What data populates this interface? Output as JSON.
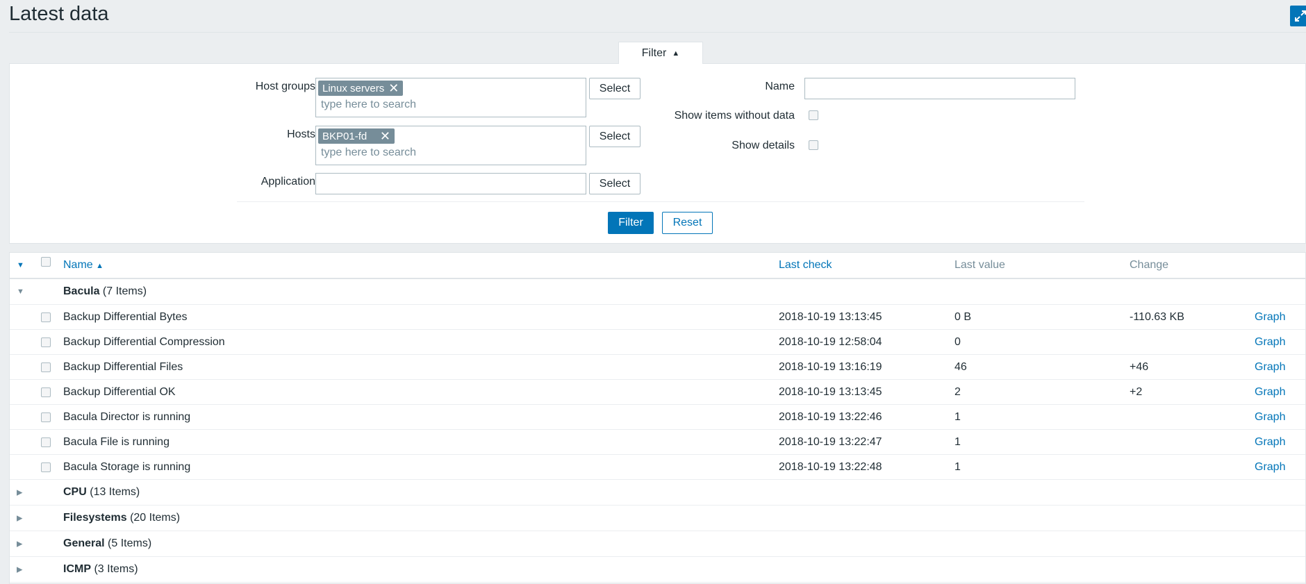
{
  "page": {
    "title": "Latest data"
  },
  "filter": {
    "tab_label": "Filter",
    "host_groups_label": "Host groups",
    "host_groups_tag": "Linux servers",
    "hosts_label": "Hosts",
    "hosts_tag": "BKP01-fd",
    "search_placeholder": "type here to search",
    "application_label": "Application",
    "select_label": "Select",
    "name_label": "Name",
    "show_without_data_label": "Show items without data",
    "show_details_label": "Show details",
    "filter_button": "Filter",
    "reset_button": "Reset"
  },
  "table": {
    "headers": {
      "name": "Name",
      "last_check": "Last check",
      "last_value": "Last value",
      "change": "Change"
    },
    "expanded_group": {
      "name": "Bacula",
      "count": "(7 Items)"
    },
    "items": [
      {
        "name": "Backup Differential Bytes",
        "last_check": "2018-10-19 13:13:45",
        "last_value": "0 B",
        "change": "-110.63 KB",
        "action": "Graph"
      },
      {
        "name": "Backup Differential Compression",
        "last_check": "2018-10-19 12:58:04",
        "last_value": "0",
        "change": "",
        "action": "Graph"
      },
      {
        "name": "Backup Differential Files",
        "last_check": "2018-10-19 13:16:19",
        "last_value": "46",
        "change": "+46",
        "action": "Graph"
      },
      {
        "name": "Backup Differential OK",
        "last_check": "2018-10-19 13:13:45",
        "last_value": "2",
        "change": "+2",
        "action": "Graph"
      },
      {
        "name": "Bacula Director is running",
        "last_check": "2018-10-19 13:22:46",
        "last_value": "1",
        "change": "",
        "action": "Graph"
      },
      {
        "name": "Bacula File is running",
        "last_check": "2018-10-19 13:22:47",
        "last_value": "1",
        "change": "",
        "action": "Graph"
      },
      {
        "name": "Bacula Storage is running",
        "last_check": "2018-10-19 13:22:48",
        "last_value": "1",
        "change": "",
        "action": "Graph"
      }
    ],
    "collapsed_groups": [
      {
        "name": "CPU",
        "count": "(13 Items)"
      },
      {
        "name": "Filesystems",
        "count": "(20 Items)"
      },
      {
        "name": "General",
        "count": "(5 Items)"
      },
      {
        "name": "ICMP",
        "count": "(3 Items)"
      }
    ]
  }
}
